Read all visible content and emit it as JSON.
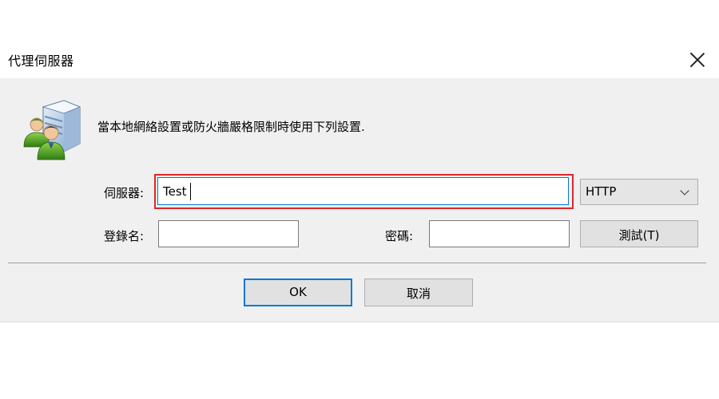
{
  "dialog": {
    "title": "代理伺服器",
    "info_text": "當本地網絡設置或防火牆嚴格限制時使用下列設置."
  },
  "icons": {
    "close": "close-icon",
    "server": "proxy-server-users-icon",
    "dropdown": "chevron-down-icon"
  },
  "form": {
    "server_label": "伺服器:",
    "server_value": "Test",
    "protocol_value": "HTTP",
    "username_label": "登錄名:",
    "username_value": "",
    "password_label": "密碼:",
    "password_value": "",
    "test_button_label": "測試(T)"
  },
  "buttons": {
    "ok_label": "OK",
    "cancel_label": "取消"
  },
  "colors": {
    "focus_blue": "#0078d7",
    "highlight_red": "#e0262b",
    "dialog_bg": "#f0f0f0"
  }
}
